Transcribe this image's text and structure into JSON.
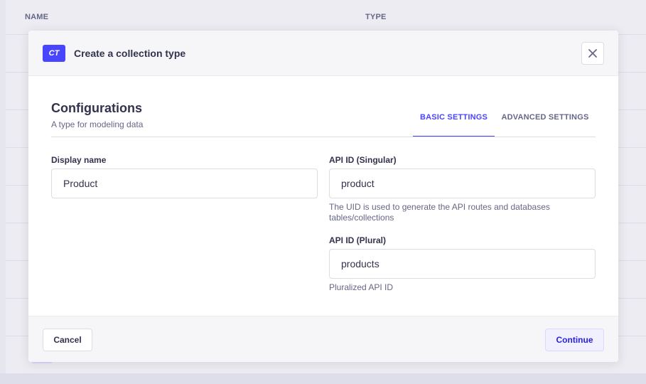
{
  "background_table": {
    "columns": [
      "NAME",
      "TYPE"
    ]
  },
  "modal": {
    "badge": "CT",
    "title": "Create a collection type",
    "section": {
      "title": "Configurations",
      "subtitle": "A type for modeling data"
    },
    "tabs": [
      {
        "label": "BASIC SETTINGS",
        "active": true
      },
      {
        "label": "ADVANCED SETTINGS",
        "active": false
      }
    ],
    "fields": {
      "display_name": {
        "label": "Display name",
        "value": "Product"
      },
      "api_singular": {
        "label": "API ID (Singular)",
        "value": "product",
        "hint": "The UID is used to generate the API routes and databases tables/collections"
      },
      "api_plural": {
        "label": "API ID (Plural)",
        "value": "products",
        "hint": "Pluralized API ID"
      }
    },
    "footer": {
      "cancel_label": "Cancel",
      "continue_label": "Continue"
    }
  },
  "colors": {
    "primary": "#4945ff",
    "text": "#32324d",
    "muted": "#666687",
    "border": "#dcdce4"
  },
  "icons": {
    "close": "close-icon"
  }
}
